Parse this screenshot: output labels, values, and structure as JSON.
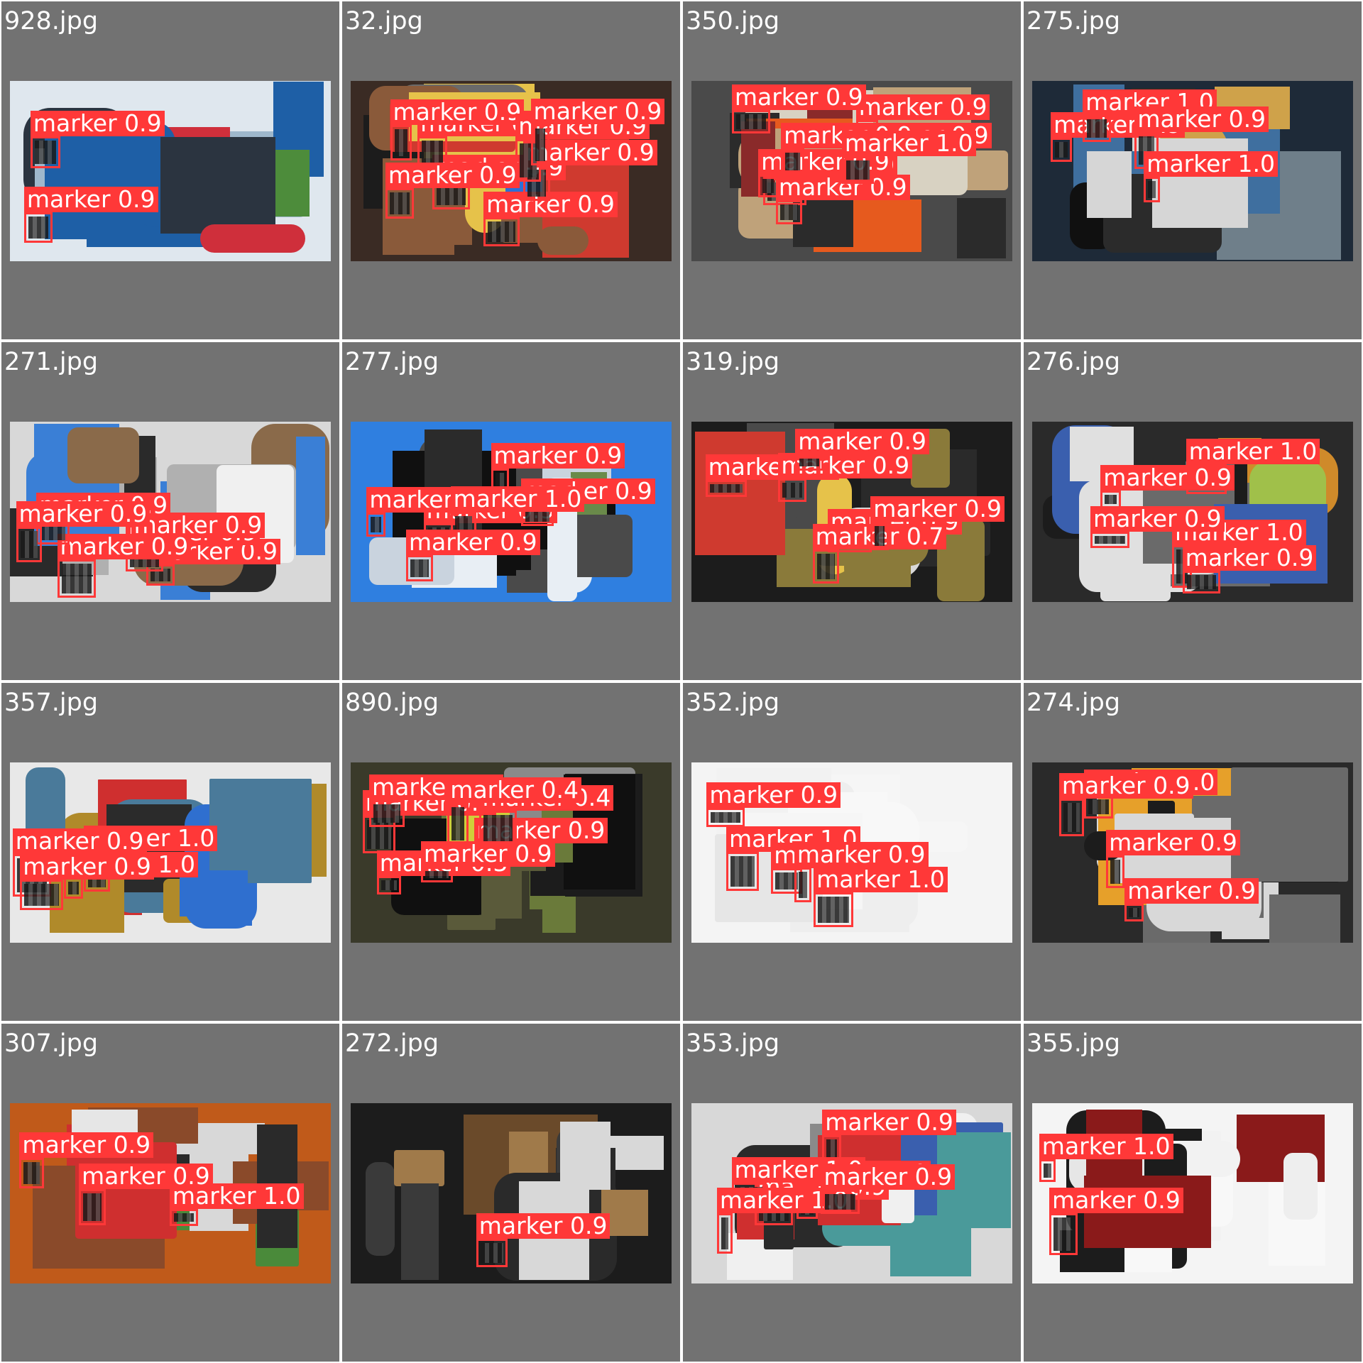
{
  "colors": {
    "background": "#727272",
    "grid_line": "#ffffff",
    "detection": "#ff3838",
    "label_text": "#ffffff"
  },
  "tiles": [
    {
      "filename": "928.jpg",
      "detections": [
        {
          "label": "marker 0.9"
        },
        {
          "label": "marker 0.9"
        }
      ]
    },
    {
      "filename": "32.jpg",
      "detections": [
        {
          "label": "marker 0.9"
        },
        {
          "label": "marker 0.9"
        },
        {
          "label": "marker 0.9"
        },
        {
          "label": "marker 0.9"
        },
        {
          "label": "marker 0.9"
        },
        {
          "label": "marker 0.9"
        },
        {
          "label": "marker 0.9"
        },
        {
          "label": "marker 0.9"
        }
      ]
    },
    {
      "filename": "350.jpg",
      "detections": [
        {
          "label": "marker 0.9"
        },
        {
          "label": "marker 0.9"
        },
        {
          "label": "marker 0.9"
        },
        {
          "label": "marker 0.9"
        },
        {
          "label": "marker 0.9"
        },
        {
          "label": "marker 0.9"
        },
        {
          "label": "marker 1.0"
        },
        {
          "label": "marker 0.9"
        }
      ]
    },
    {
      "filename": "275.jpg",
      "detections": [
        {
          "label": "marker 0.9"
        },
        {
          "label": "marker 1.0"
        },
        {
          "label": "marker 0.9"
        },
        {
          "label": "marker 1.0"
        }
      ]
    },
    {
      "filename": "271.jpg",
      "detections": [
        {
          "label": "marker 0.9"
        },
        {
          "label": "marker 0.9"
        },
        {
          "label": "marker 0.9"
        },
        {
          "label": "marker 0.9"
        },
        {
          "label": "marker 0.9"
        },
        {
          "label": "marker 0.9"
        }
      ]
    },
    {
      "filename": "277.jpg",
      "detections": [
        {
          "label": "marker 0.9"
        },
        {
          "label": "marker 0.9"
        },
        {
          "label": "marker 0.9"
        },
        {
          "label": "marker 0.9"
        },
        {
          "label": "marker 1.0"
        },
        {
          "label": "marker 0.9"
        }
      ]
    },
    {
      "filename": "319.jpg",
      "detections": [
        {
          "label": "marker 0.9"
        },
        {
          "label": "marker 0.9"
        },
        {
          "label": "marker 0.9"
        },
        {
          "label": "marker 0.7"
        },
        {
          "label": "marker 0.9"
        },
        {
          "label": "marker 0.9"
        }
      ]
    },
    {
      "filename": "276.jpg",
      "detections": [
        {
          "label": "marker 1.0"
        },
        {
          "label": "marker 0.9"
        },
        {
          "label": "marker 1.0"
        },
        {
          "label": "marker 0.9"
        },
        {
          "label": "marker 0.9"
        }
      ]
    },
    {
      "filename": "357.jpg",
      "detections": [
        {
          "label": "marker 1.0"
        },
        {
          "label": "marker 1.0"
        },
        {
          "label": "marker 0.9"
        },
        {
          "label": "marker 0.9"
        }
      ]
    },
    {
      "filename": "890.jpg",
      "detections": [
        {
          "label": "marker 0.9"
        },
        {
          "label": "marker 0.9"
        },
        {
          "label": "marker 0.9"
        },
        {
          "label": "marker 0.4"
        },
        {
          "label": "marker 0.3"
        },
        {
          "label": "marker 0.9"
        },
        {
          "label": "marker 0.4"
        }
      ]
    },
    {
      "filename": "352.jpg",
      "detections": [
        {
          "label": "marker 1.0"
        },
        {
          "label": "marker 0.9"
        },
        {
          "label": "marker 1.0"
        },
        {
          "label": "marker 0.9"
        },
        {
          "label": "marker 0.9"
        }
      ]
    },
    {
      "filename": "274.jpg",
      "detections": [
        {
          "label": "marker 0.9"
        },
        {
          "label": "marker 0.9"
        },
        {
          "label": "marker 1.0"
        },
        {
          "label": "marker 0.9"
        }
      ]
    },
    {
      "filename": "307.jpg",
      "detections": [
        {
          "label": "marker 0.9"
        },
        {
          "label": "marker 1.0"
        },
        {
          "label": "marker 0.9"
        }
      ]
    },
    {
      "filename": "272.jpg",
      "detections": [
        {
          "label": "marker 0.9"
        }
      ]
    },
    {
      "filename": "353.jpg",
      "detections": [
        {
          "label": "marker 0.9"
        },
        {
          "label": "marker 0.9"
        },
        {
          "label": "marker 1.0"
        },
        {
          "label": "marker 1.0"
        },
        {
          "label": "marker 1.0"
        },
        {
          "label": "marker 0.9"
        }
      ]
    },
    {
      "filename": "355.jpg",
      "detections": [
        {
          "label": "marker 1.0"
        },
        {
          "label": "marker 0.9"
        }
      ]
    }
  ]
}
